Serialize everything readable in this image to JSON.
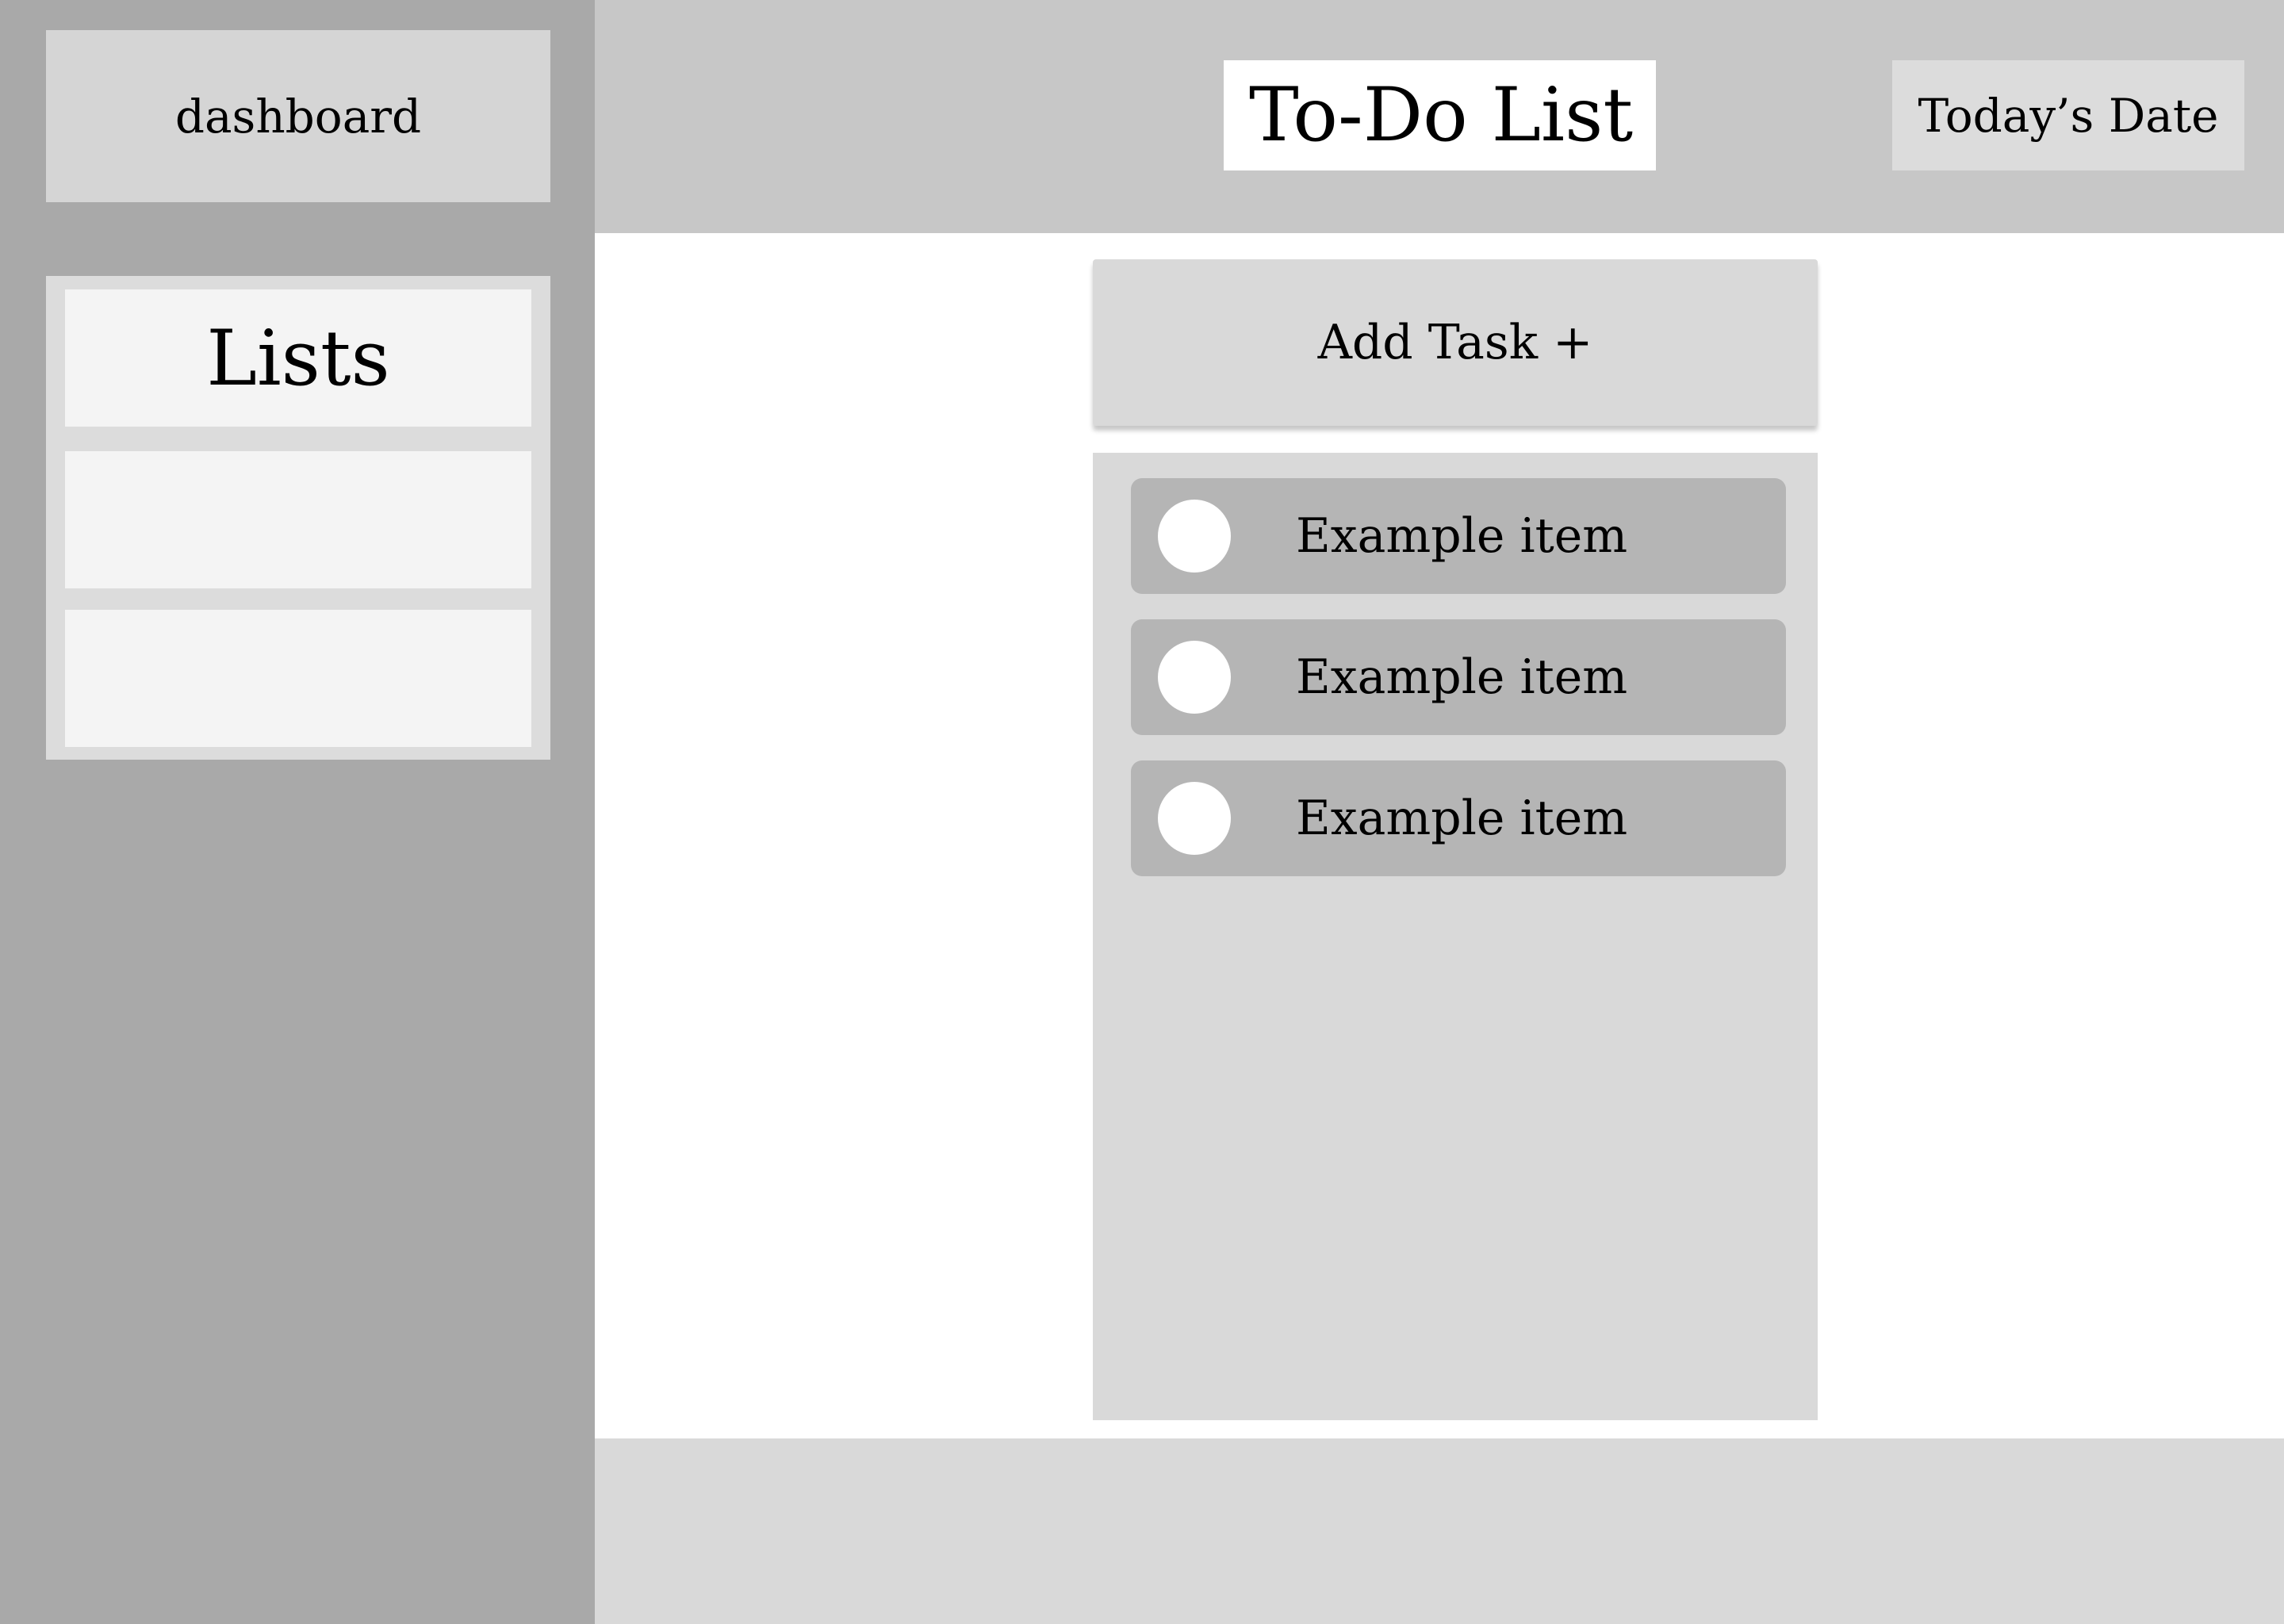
{
  "sidebar": {
    "dashboard_label": "dashboard",
    "lists": {
      "title": "Lists"
    }
  },
  "header": {
    "title": "To-Do List",
    "date_label": "Today’s Date"
  },
  "main": {
    "add_task_label": "Add Task +",
    "tasks": [
      {
        "label": "Example item",
        "checked": false
      },
      {
        "label": "Example item",
        "checked": false
      },
      {
        "label": "Example item",
        "checked": false
      }
    ]
  },
  "colors": {
    "sidebar_bg": "#a9a9a9",
    "header_bg": "#c7c7c7",
    "panel_bg": "#d9d9d9",
    "task_item_bg": "#b5b5b5",
    "list_slot_bg": "#f4f4f4"
  }
}
